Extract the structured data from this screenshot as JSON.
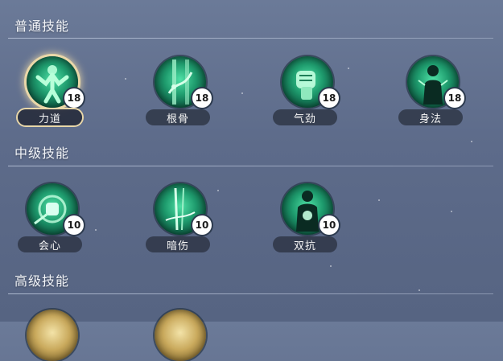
{
  "sections": [
    {
      "title": "普通技能",
      "skills": [
        {
          "name": "力道",
          "level": "18",
          "icon": "muscle-figure-icon",
          "selected": true
        },
        {
          "name": "根骨",
          "level": "18",
          "icon": "bamboo-vine-icon",
          "selected": false
        },
        {
          "name": "气劲",
          "level": "18",
          "icon": "fist-icon",
          "selected": false
        },
        {
          "name": "身法",
          "level": "18",
          "icon": "warrior-figure-icon",
          "selected": false
        }
      ]
    },
    {
      "title": "中级技能",
      "skills": [
        {
          "name": "会心",
          "level": "10",
          "icon": "glowing-fist-icon",
          "selected": false
        },
        {
          "name": "暗伤",
          "level": "10",
          "icon": "blade-strike-icon",
          "selected": false
        },
        {
          "name": "双抗",
          "level": "10",
          "icon": "shielded-figure-icon",
          "selected": false
        }
      ]
    },
    {
      "title": "高级技能",
      "skills": []
    }
  ],
  "colors": {
    "icon_green": "#1f9c6e",
    "icon_gold": "#c9a95c",
    "selected_glow": "#e9d7a8",
    "background": "#5d6b8a"
  }
}
